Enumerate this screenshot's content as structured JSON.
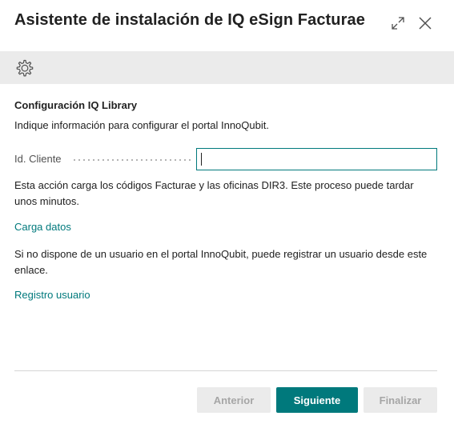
{
  "dialog": {
    "title": "Asistente de instalación de IQ eSign Facturae",
    "expand_icon": "expand-icon",
    "close_icon": "close-icon"
  },
  "toolbar": {
    "settings_icon": "gear-icon"
  },
  "content": {
    "section_title": "Configuración IQ Library",
    "intro": "Indique información para configurar el portal InnoQubit.",
    "client_id": {
      "label": "Id. Cliente",
      "value": ""
    },
    "load_description": "Esta acción carga los códigos Facturae y las oficinas DIR3. Este proceso puede tardar unos minutos.",
    "load_link": "Carga datos",
    "register_description": "Si no dispone de un usuario en el portal InnoQubit, puede registrar un usuario desde este enlace.",
    "register_link": "Registro usuario"
  },
  "footer": {
    "back_label": "Anterior",
    "next_label": "Siguiente",
    "finish_label": "Finalizar"
  },
  "colors": {
    "accent": "#00797c",
    "toolbar_bg": "#ebebeb",
    "disabled_bg": "#ebebeb",
    "disabled_text": "#a6a6a6"
  }
}
